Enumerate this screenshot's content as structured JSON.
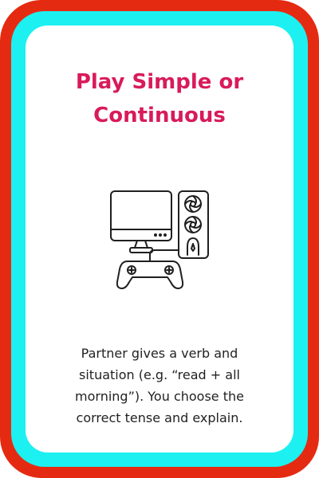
{
  "card": {
    "title_lines": [
      "Play Simple or",
      "Continuous"
    ],
    "icon": "gaming-pc-with-controller-icon",
    "description_lines": [
      "Partner gives a verb and",
      "situation (e.g. “read + all",
      "morning”). You choose the",
      "correct tense and explain."
    ]
  },
  "colors": {
    "outer_border": "#e52a12",
    "inner_border": "#1df0f1",
    "title": "#d81b5a",
    "text": "#222222",
    "card_background": "#ffffff"
  }
}
